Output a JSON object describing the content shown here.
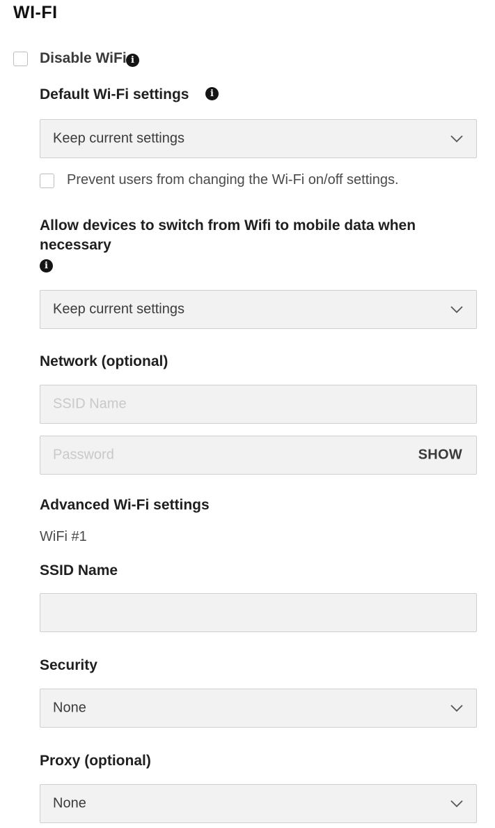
{
  "section": {
    "title": "WI-FI"
  },
  "disable_wifi": {
    "label": "Disable WiFi",
    "checked": false,
    "info_icon": "info-icon"
  },
  "default_wifi": {
    "label": "Default Wi-Fi settings",
    "info_icon": "info-icon",
    "select_value": "Keep current settings",
    "prevent_label": "Prevent users from changing the Wi-Fi on/off settings.",
    "prevent_checked": false
  },
  "switch_mobile": {
    "label_line1": "Allow devices to switch from Wifi to mobile data when",
    "label_line2": "necessary",
    "info_icon": "info-icon",
    "select_value": "Keep current settings"
  },
  "network": {
    "label": "Network (optional)",
    "ssid_placeholder": "SSID Name",
    "password_placeholder": "Password",
    "show_label": "SHOW"
  },
  "advanced": {
    "label": "Advanced Wi-Fi settings",
    "wifi_item": "WiFi #1",
    "ssid_label": "SSID Name",
    "ssid_value": "",
    "security_label": "Security",
    "security_value": "None",
    "proxy_label": "Proxy (optional)",
    "proxy_value": "None"
  },
  "colors": {
    "field_bg": "#f2f2f2",
    "field_border": "#cfcfcf",
    "text": "#1e1e1e"
  }
}
